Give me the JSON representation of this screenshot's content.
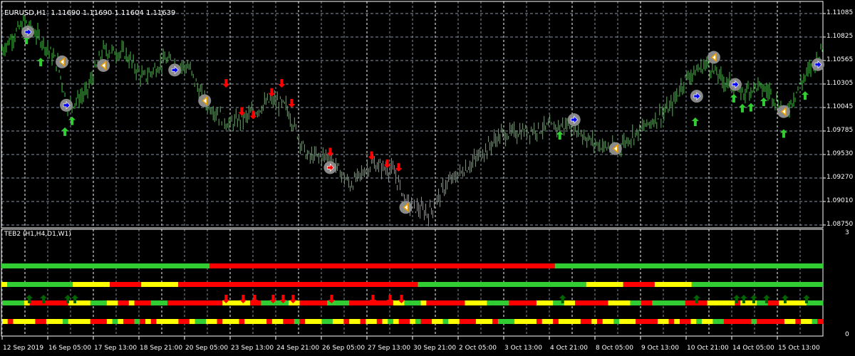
{
  "header": {
    "symbol": "EURUSD,H1",
    "ohlc": "1.11690 1.11690 1.11604 1.11639"
  },
  "indicator": {
    "title": "TEB2 (H1,H4,D1,W1)",
    "scale_max": "3",
    "scale_min": "0"
  },
  "colors": {
    "background": "#000000",
    "bars": "#32CD32",
    "grid": "#8A95A5",
    "up": "#32CD32",
    "down": "#FF0000",
    "yellow": "#FFFF00",
    "dark_up": "#006400",
    "circle": "#8A8A8A"
  },
  "price_axis": [
    "1.11085",
    "1.10825",
    "1.10565",
    "1.10305",
    "1.10045",
    "1.09785",
    "1.09530",
    "1.09270",
    "1.09010",
    "1.08750"
  ],
  "time_axis": [
    "12 Sep 2019",
    "16 Sep 05:00",
    "17 Sep 13:00",
    "18 Sep 21:00",
    "20 Sep 05:00",
    "23 Sep 13:00",
    "24 Sep 21:00",
    "26 Sep 05:00",
    "27 Sep 13:00",
    "30 Sep 21:00",
    "2 Oct 05:00",
    "3 Oct 13:00",
    "4 Oct 21:00",
    "8 Oct 05:00",
    "9 Oct 13:00",
    "10 Oct 21:00",
    "14 Oct 05:00",
    "15 Oct 13:00"
  ],
  "chart_data": {
    "type": "line",
    "ylim": [
      1.0872,
      1.1113
    ],
    "bars_total": 576,
    "price_path": [
      [
        0,
        1.10683
      ],
      [
        16,
        1.10998
      ],
      [
        29,
        1.10762
      ],
      [
        39,
        1.10526
      ],
      [
        46,
        1.10053
      ],
      [
        59,
        1.1021
      ],
      [
        71,
        1.10683
      ],
      [
        86,
        1.10644
      ],
      [
        99,
        1.10368
      ],
      [
        114,
        1.10565
      ],
      [
        131,
        1.10486
      ],
      [
        141,
        1.10132
      ],
      [
        159,
        1.09856
      ],
      [
        171,
        1.09935
      ],
      [
        189,
        1.10132
      ],
      [
        199,
        1.10053
      ],
      [
        214,
        1.09501
      ],
      [
        229,
        1.09501
      ],
      [
        244,
        1.09186
      ],
      [
        259,
        1.09422
      ],
      [
        274,
        1.09344
      ],
      [
        284,
        1.08989
      ],
      [
        299,
        1.08871
      ],
      [
        311,
        1.09186
      ],
      [
        329,
        1.09422
      ],
      [
        349,
        1.09738
      ],
      [
        379,
        1.09816
      ],
      [
        399,
        1.09856
      ],
      [
        414,
        1.09659
      ],
      [
        429,
        1.0958
      ],
      [
        449,
        1.09816
      ],
      [
        469,
        1.10053
      ],
      [
        479,
        1.10368
      ],
      [
        494,
        1.10526
      ],
      [
        504,
        1.10368
      ],
      [
        519,
        1.1021
      ],
      [
        529,
        1.10289
      ],
      [
        539,
        1.1021
      ],
      [
        549,
        1.09974
      ],
      [
        559,
        1.10289
      ],
      [
        575,
        1.10683
      ]
    ],
    "signals_circle": [
      [
        18,
        1.1088,
        "buy"
      ],
      [
        42,
        1.1055,
        "exit"
      ],
      [
        45,
        1.1007,
        "buy"
      ],
      [
        71,
        1.1051,
        "exit"
      ],
      [
        121,
        1.1046,
        "buy"
      ],
      [
        142,
        1.1012,
        "exit"
      ],
      [
        230,
        1.0938,
        "sell"
      ],
      [
        283,
        1.0894,
        "exit"
      ],
      [
        401,
        1.0991,
        "buy"
      ],
      [
        430,
        1.0959,
        "exit"
      ],
      [
        487,
        1.1017,
        "buy"
      ],
      [
        499,
        1.106,
        "exit"
      ],
      [
        514,
        1.103,
        "buy"
      ],
      [
        548,
        1.1,
        "exit"
      ],
      [
        572,
        1.1052,
        "buy"
      ]
    ],
    "arrows_up": [
      [
        17,
        1.10785
      ],
      [
        27,
        1.1054
      ],
      [
        44,
        1.0977
      ],
      [
        49,
        1.0989
      ],
      [
        391,
        1.0973
      ],
      [
        486,
        1.0988
      ],
      [
        513,
        1.1014
      ],
      [
        519,
        1.1003
      ],
      [
        525,
        1.1004
      ],
      [
        534,
        1.101
      ],
      [
        548,
        1.0975
      ],
      [
        563,
        1.1017
      ]
    ],
    "arrows_down": [
      [
        157,
        1.1032
      ],
      [
        168,
        1.1001
      ],
      [
        176,
        1.0997
      ],
      [
        189,
        1.1022
      ],
      [
        196,
        1.1032
      ],
      [
        203,
        1.101
      ],
      [
        230,
        1.0956
      ],
      [
        259,
        1.0952
      ],
      [
        270,
        1.0943
      ],
      [
        278,
        1.0939
      ]
    ],
    "teb_rows": [
      {
        "name": "W1",
        "segments": [
          [
            0,
            146,
            "G"
          ],
          [
            146,
            388,
            "R"
          ],
          [
            388,
            576,
            "G"
          ]
        ]
      },
      {
        "name": "D1",
        "segments": [
          [
            0,
            4,
            "Y"
          ],
          [
            4,
            50,
            "G"
          ],
          [
            50,
            76,
            "Y"
          ],
          [
            76,
            98,
            "R"
          ],
          [
            98,
            124,
            "Y"
          ],
          [
            124,
            292,
            "R"
          ],
          [
            292,
            410,
            "G"
          ],
          [
            410,
            436,
            "Y"
          ],
          [
            436,
            458,
            "R"
          ],
          [
            458,
            484,
            "Y"
          ],
          [
            484,
            576,
            "G"
          ]
        ]
      },
      {
        "name": "H4",
        "cells": "GGGGYRRRRRRRYYYYGGGYYRRYRRRGGGRRRRRRRRRRYYYYYRRGGGGGYYRRRRRGGGGRRRRRRRRYYGGGYRRRRRRRYYYYGGGGRRRRRYYYGGYYRRRRRRYYYYGGRRGGGGGGRRRRYYYYYRYYYGGRRYYYYYGGG"
      },
      {
        "name": "H1",
        "cells": "YRYYYYRRYYYGYYYYRRRYGYRRGRYRYYYYRRYGGYYRYYYRYYYYRYYRRGRYYYGGYYRYYRYYRYGYRRYGRRYYGYYRRRYYYRGGGYYYYRYYRYYYYRRYRYYGYYYRRRRYYRYRRYGYYGGRRRRRGRRRRRYYRYYGR"
      }
    ],
    "teb_up": [
      19,
      29,
      46,
      51,
      393,
      487,
      515,
      520,
      527,
      536,
      549,
      564
    ],
    "teb_down": [
      157,
      169,
      177,
      190,
      197,
      204,
      231,
      260,
      272,
      280
    ]
  }
}
